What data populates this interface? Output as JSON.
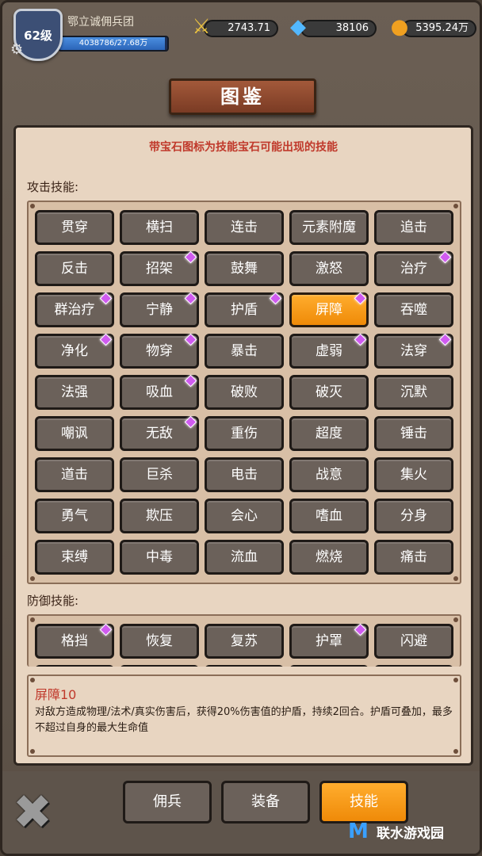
{
  "player": {
    "level": "62级",
    "guild": "鄂立诚佣兵团",
    "exp": "4038786/27.68万",
    "exp_fill": 0.98
  },
  "resources": [
    {
      "name": "power",
      "icon": "swords-icon",
      "value": "2743.71"
    },
    {
      "name": "gem",
      "icon": "diamond-icon",
      "value": "38106"
    },
    {
      "name": "gold",
      "icon": "coins-icon",
      "value": "5395.24万"
    }
  ],
  "title": "图鉴",
  "hint": "带宝石图标为技能宝石可能出现的技能",
  "attack_label": "攻击技能:",
  "defense_label": "防御技能:",
  "attack_skills": [
    {
      "label": "贯穿",
      "gem": false
    },
    {
      "label": "横扫",
      "gem": false
    },
    {
      "label": "连击",
      "gem": false
    },
    {
      "label": "元素附魔",
      "gem": false
    },
    {
      "label": "追击",
      "gem": false
    },
    {
      "label": "反击",
      "gem": false
    },
    {
      "label": "招架",
      "gem": true
    },
    {
      "label": "鼓舞",
      "gem": false
    },
    {
      "label": "激怒",
      "gem": false
    },
    {
      "label": "治疗",
      "gem": true
    },
    {
      "label": "群治疗",
      "gem": true
    },
    {
      "label": "宁静",
      "gem": true
    },
    {
      "label": "护盾",
      "gem": true
    },
    {
      "label": "屏障",
      "gem": true,
      "selected": true
    },
    {
      "label": "吞噬",
      "gem": false
    },
    {
      "label": "净化",
      "gem": true
    },
    {
      "label": "物穿",
      "gem": true
    },
    {
      "label": "暴击",
      "gem": false
    },
    {
      "label": "虚弱",
      "gem": true
    },
    {
      "label": "法穿",
      "gem": true
    },
    {
      "label": "法强",
      "gem": false
    },
    {
      "label": "吸血",
      "gem": true
    },
    {
      "label": "破败",
      "gem": false
    },
    {
      "label": "破灭",
      "gem": false
    },
    {
      "label": "沉默",
      "gem": false
    },
    {
      "label": "嘲讽",
      "gem": false
    },
    {
      "label": "无敌",
      "gem": true
    },
    {
      "label": "重伤",
      "gem": false
    },
    {
      "label": "超度",
      "gem": false
    },
    {
      "label": "锤击",
      "gem": false
    },
    {
      "label": "道击",
      "gem": false
    },
    {
      "label": "巨杀",
      "gem": false
    },
    {
      "label": "电击",
      "gem": false
    },
    {
      "label": "战意",
      "gem": false
    },
    {
      "label": "集火",
      "gem": false
    },
    {
      "label": "勇气",
      "gem": false
    },
    {
      "label": "欺压",
      "gem": false
    },
    {
      "label": "会心",
      "gem": false
    },
    {
      "label": "嗜血",
      "gem": false
    },
    {
      "label": "分身",
      "gem": false
    },
    {
      "label": "束缚",
      "gem": false
    },
    {
      "label": "中毒",
      "gem": false
    },
    {
      "label": "流血",
      "gem": false
    },
    {
      "label": "燃烧",
      "gem": false
    },
    {
      "label": "痛击",
      "gem": false
    }
  ],
  "defense_skills": [
    {
      "label": "格挡",
      "gem": true
    },
    {
      "label": "恢复",
      "gem": false
    },
    {
      "label": "复苏",
      "gem": false
    },
    {
      "label": "护罩",
      "gem": true
    },
    {
      "label": "闪避",
      "gem": false
    }
  ],
  "detail": {
    "title": "屏障10",
    "text": "对敌方造成物理/法术/真实伤害后，获得20%伤害值的护盾，持续2回合。护盾可叠加，最多不超过自身的最大生命值"
  },
  "tabs": [
    {
      "label": "佣兵",
      "active": false
    },
    {
      "label": "装备",
      "active": false
    },
    {
      "label": "技能",
      "active": true
    }
  ],
  "watermark": "联水游戏园",
  "colors": {
    "selected": "#ef8a08",
    "hint": "#c0392b",
    "gem": "#d05bf0"
  }
}
